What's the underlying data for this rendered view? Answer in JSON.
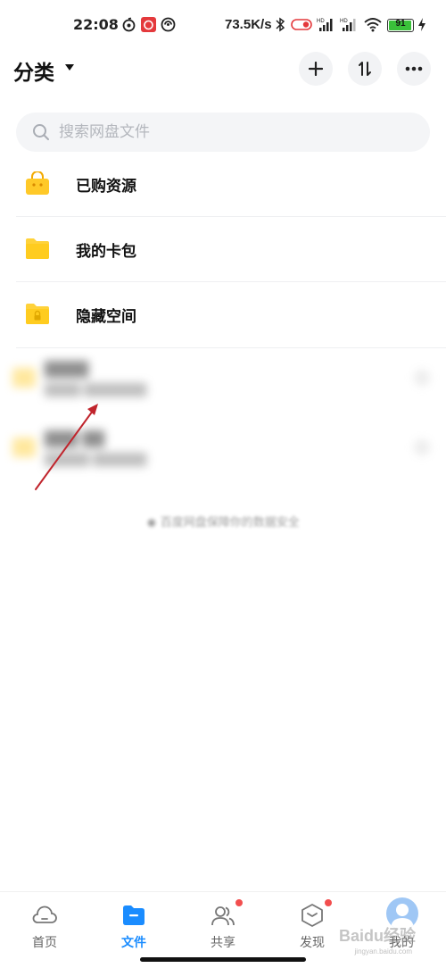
{
  "status_bar": {
    "time": "22:08",
    "net_speed": "73.5K/s",
    "battery": "91",
    "battery_level": 0.91,
    "icons": [
      "netease-music-icon",
      "netease-app-icon",
      "sync-icon",
      "bluetooth-icon",
      "alarm-icon",
      "signal-hd-icon",
      "signal-hd-icon-2",
      "wifi-icon",
      "charging-icon"
    ]
  },
  "header": {
    "title": "分类",
    "buttons": [
      "plus-icon",
      "sort-icon",
      "more-icon"
    ]
  },
  "search": {
    "placeholder": "搜索网盘文件"
  },
  "categories": [
    {
      "label": "已购资源",
      "icon": "shopping-bag-icon"
    },
    {
      "label": "我的卡包",
      "icon": "folder-icon"
    },
    {
      "label": "隐藏空间",
      "icon": "locked-folder-icon"
    }
  ],
  "blurred_files": [
    {
      "name": "████",
      "meta": "████ ███████"
    },
    {
      "name": "███ ██",
      "meta": "█████ ██████"
    }
  ],
  "safety_note": "百度网盘保障你的数据安全",
  "bottom_nav": {
    "items": [
      {
        "label": "首页",
        "icon": "home-cloud-icon",
        "active": false,
        "badge": false
      },
      {
        "label": "文件",
        "icon": "file-folder-icon",
        "active": true,
        "badge": false
      },
      {
        "label": "共享",
        "icon": "share-users-icon",
        "active": false,
        "badge": true
      },
      {
        "label": "发现",
        "icon": "discover-box-icon",
        "active": false,
        "badge": true
      },
      {
        "label": "我的",
        "icon": "avatar",
        "active": false,
        "badge": false
      }
    ]
  },
  "watermark": {
    "text": "Baidu经验",
    "sub": "jingyan.baidu.com"
  },
  "colors": {
    "accent": "#1a8cff",
    "folder": "#ffd23a",
    "badge": "#f24e4e",
    "annotation": "#c0242c"
  }
}
